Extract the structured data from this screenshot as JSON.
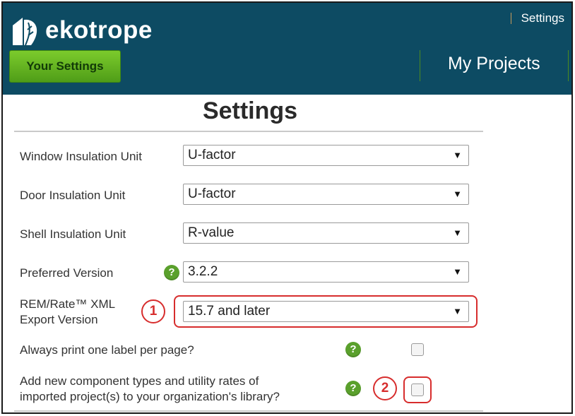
{
  "header": {
    "logo_text": "ekotrope",
    "top_link": "Settings",
    "your_settings_button": "Your Settings",
    "my_projects_link": "My Projects",
    "background_color": "#0d4b63",
    "accent_green": "#5aa02c"
  },
  "page": {
    "title": "Settings"
  },
  "settings": {
    "window_insulation": {
      "label": "Window Insulation Unit",
      "value": "U-factor"
    },
    "door_insulation": {
      "label": "Door Insulation Unit",
      "value": "U-factor"
    },
    "shell_insulation": {
      "label": "Shell Insulation Unit",
      "value": "R-value"
    },
    "preferred_version": {
      "label": "Preferred Version",
      "value": "3.2.2",
      "help_icon": "question-icon"
    },
    "remrate_export": {
      "label_line1": "REM/Rate™ XML",
      "label_line2": "Export Version",
      "value": "15.7 and later",
      "callout_number": "1"
    },
    "print_label": {
      "label": "Always print one label per page?",
      "checked": false,
      "help_icon": "question-icon"
    },
    "add_component": {
      "label_line1": "Add new component types and utility rates of",
      "label_line2": "imported project(s) to your organization's library?",
      "checked": false,
      "help_icon": "question-icon",
      "callout_number": "2"
    }
  },
  "icons": {
    "dropdown": "▼",
    "help": "?"
  },
  "annotation_color": "#d72d2d"
}
